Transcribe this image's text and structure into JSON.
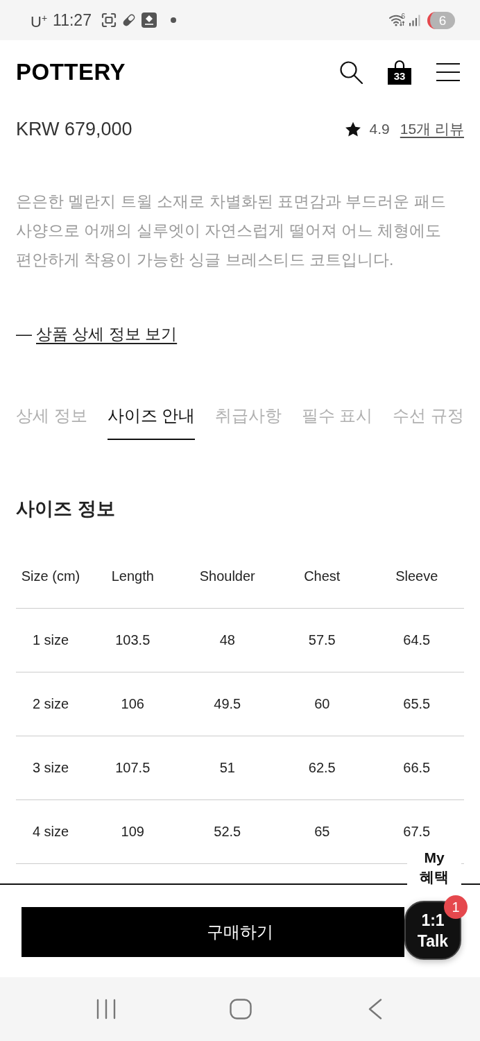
{
  "status_bar": {
    "carrier": "U$^{+}$",
    "time": "11:27",
    "wifi_badge": "6",
    "battery": "6"
  },
  "header": {
    "logo": "POTTERY",
    "cart_count": "33"
  },
  "product": {
    "price": "KRW 679,000",
    "rating": "4.9",
    "reviews": "15개 리뷰",
    "description": "은은한 멜란지 트윌 소재로 차별화된 표면감과 부드러운 패드 사양으로 어깨의 실루엣이 자연스럽게 떨어져 어느 체형에도 편안하게 착용이 가능한 싱글 브레스티드 코트입니다.",
    "detail_link": {
      "prefix": "—",
      "label": "상품 상세 정보 보기"
    }
  },
  "tabs": [
    {
      "label": "상세 정보",
      "selected": false
    },
    {
      "label": "사이즈 안내",
      "selected": true
    },
    {
      "label": "취급사항",
      "selected": false
    },
    {
      "label": "필수 표시",
      "selected": false
    },
    {
      "label": "수선 규정",
      "selected": false
    }
  ],
  "size_info": {
    "title": "사이즈 정보",
    "columns": [
      "Size (cm)",
      "Length",
      "Shoulder",
      "Chest",
      "Sleeve"
    ],
    "rows": [
      [
        "1 size",
        "103.5",
        "48",
        "57.5",
        "64.5"
      ],
      [
        "2 size",
        "106",
        "49.5",
        "60",
        "65.5"
      ],
      [
        "3 size",
        "107.5",
        "51",
        "62.5",
        "66.5"
      ],
      [
        "4 size",
        "109",
        "52.5",
        "65",
        "67.5"
      ]
    ]
  },
  "floating": {
    "my_benefits": "My 혜택",
    "talk": "1:1 Talk",
    "talk_badge": "1"
  },
  "buy_button": "구매하기"
}
